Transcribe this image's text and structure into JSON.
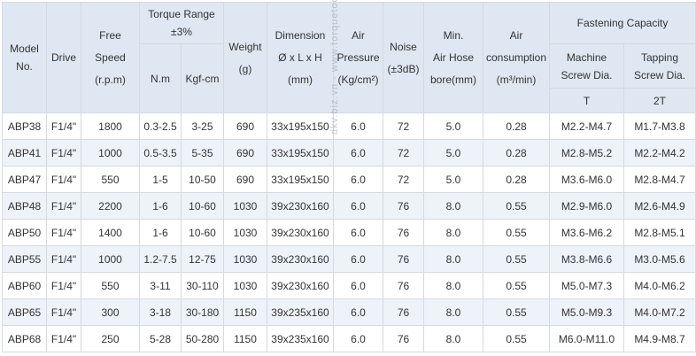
{
  "headers": {
    "model": [
      "Model",
      "No."
    ],
    "drive": "Drive",
    "free_speed": [
      "Free",
      "Speed",
      "(r.p.m)"
    ],
    "torque_range": [
      "Torque Range",
      "±3%"
    ],
    "torque_nm": "N.m",
    "torque_kgf": "Kgf-cm",
    "weight": [
      "Weight",
      "(g)"
    ],
    "dimension": [
      "Dimension",
      "Ø x L x H",
      "(mm)"
    ],
    "air_pressure": [
      "Air",
      "Pressure",
      "(Kg/cm²)"
    ],
    "noise": [
      "Noise",
      "(±3dB)"
    ],
    "min_air_hose": [
      "Min.",
      "Air Hose",
      "bore(mm)"
    ],
    "air_consumption": [
      "Air",
      "consumption",
      "(m³/min)"
    ],
    "fastening_capacity": "Fastening Capacity",
    "machine_screw": [
      "Machine",
      "Screw Dia."
    ],
    "tapping_screw": [
      "Tapping",
      "Screw Dia."
    ],
    "machine_code": "T",
    "tapping_code": "2T"
  },
  "rows": [
    [
      "ABP38",
      "F1/4\"",
      "1800",
      "0.3-2.5",
      "3-25",
      "690",
      "33x195x150",
      "6.0",
      "72",
      "5.0",
      "0.28",
      "M2.2-M4.7",
      "M1.7-M3.8"
    ],
    [
      "ABP41",
      "F1/4\"",
      "1000",
      "0.5-3.5",
      "5-35",
      "690",
      "33x195x150",
      "6.0",
      "72",
      "5.0",
      "0.28",
      "M2.8-M5.2",
      "M2.2-M4.2"
    ],
    [
      "ABP47",
      "F1/4\"",
      "550",
      "1-5",
      "10-50",
      "690",
      "33x195x150",
      "6.0",
      "72",
      "5.0",
      "0.28",
      "M3.6-M6.0",
      "M2.8-M4.7"
    ],
    [
      "ABP48",
      "F1/4\"",
      "2200",
      "1-6",
      "10-60",
      "1030",
      "39x230x160",
      "6.0",
      "76",
      "8.0",
      "0.55",
      "M2.9-M6.0",
      "M2.6-M4.9"
    ],
    [
      "ABP50",
      "F1/4\"",
      "1400",
      "1-6",
      "10-60",
      "1030",
      "39x230x160",
      "6.0",
      "76",
      "8.0",
      "0.55",
      "M3.6-M6.2",
      "M2.8-M5.1"
    ],
    [
      "ABP55",
      "F1/4\"",
      "1000",
      "1.2-7.5",
      "12-75",
      "1030",
      "39x230x160",
      "6.0",
      "76",
      "8.0",
      "0.55",
      "M3.8-M6.6",
      "M3.0-M5.6"
    ],
    [
      "ABP60",
      "F1/4\"",
      "550",
      "3-11",
      "30-110",
      "1030",
      "39x230x160",
      "6.0",
      "76",
      "8.0",
      "0.55",
      "M5.0-M7.3",
      "M4.0-M6.2"
    ],
    [
      "ABP65",
      "F1/4\"",
      "300",
      "3-18",
      "30-180",
      "1150",
      "39x235x160",
      "6.0",
      "76",
      "8.0",
      "0.55",
      "M5.0-M9.3",
      "M4.0-M7.2"
    ],
    [
      "ABP68",
      "F1/4\"",
      "250",
      "5-28",
      "50-280",
      "1150",
      "39x235x160",
      "6.0",
      "76",
      "8.0",
      "0.55",
      "M6.0-M11.0",
      "M4.9-M8.7"
    ]
  ],
  "watermark": "dkv.biz.vn - www.torquetools.com.vn"
}
